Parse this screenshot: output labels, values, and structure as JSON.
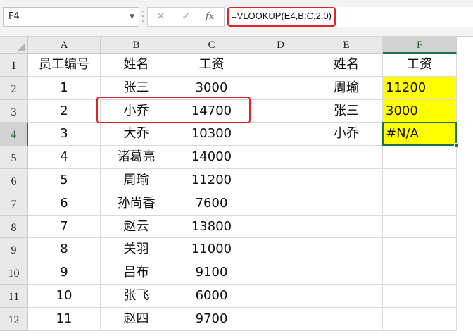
{
  "toolbar": {
    "name_box": "F4",
    "cancel_symbol": "✕",
    "enter_symbol": "✓",
    "fx_symbol": "fx",
    "formula": "=VLOOKUP(E4,B:C,2,0)"
  },
  "columns": [
    "A",
    "B",
    "C",
    "D",
    "E",
    "F"
  ],
  "rows": [
    "1",
    "2",
    "3",
    "4",
    "5",
    "6",
    "7",
    "8",
    "9",
    "10",
    "11",
    "12"
  ],
  "table": {
    "headers": [
      "员工编号",
      "姓名",
      "工资"
    ],
    "rows": [
      [
        "1",
        "张三",
        "3000"
      ],
      [
        "2",
        "小乔",
        "14700"
      ],
      [
        "3",
        "大乔",
        "10300"
      ],
      [
        "4",
        "诸葛亮",
        "14000"
      ],
      [
        "5",
        "周瑜",
        "11200"
      ],
      [
        "6",
        "孙尚香",
        "7600"
      ],
      [
        "7",
        "赵云",
        "13800"
      ],
      [
        "8",
        "关羽",
        "11000"
      ],
      [
        "9",
        "吕布",
        "9100"
      ],
      [
        "10",
        "张飞",
        "6000"
      ],
      [
        "11",
        "赵四",
        "9700"
      ]
    ]
  },
  "lookup": {
    "headers": [
      "姓名",
      "工资"
    ],
    "rows": [
      [
        "周瑜",
        "11200"
      ],
      [
        "张三",
        "3000"
      ],
      [
        "小乔",
        "#N/A"
      ]
    ]
  },
  "colors": {
    "selection": "#217346",
    "highlight": "#ffff00",
    "annotation": "#e0252a"
  }
}
